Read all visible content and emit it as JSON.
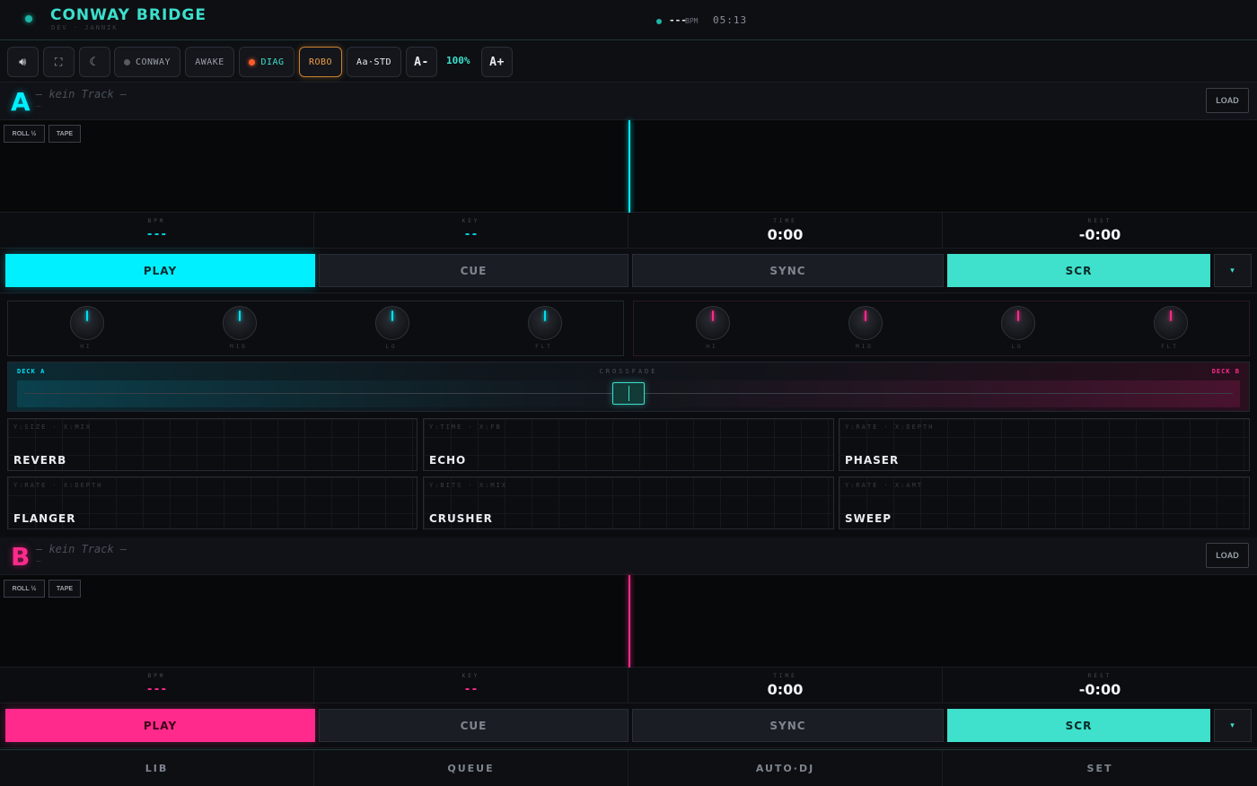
{
  "header": {
    "title": "CONWAY BRIDGE",
    "subtitle": "DEV · JANNIK",
    "bpm": "---",
    "bpm_unit": "BPM",
    "clock": "05:13"
  },
  "toolbar": {
    "conway_label": "CONWAY",
    "awake_label": "AWAKE",
    "diag_label": "DIAG",
    "robo_label": "ROBO",
    "font_std_label": "Aa·STD",
    "font_down_label": "A-",
    "zoom": "100%",
    "font_up_label": "A+"
  },
  "colors": {
    "deck_a": "#00f0ff",
    "deck_b": "#ff2a8c",
    "accent": "#3be0cc",
    "robo": "#f0a04b"
  },
  "deck_a": {
    "letter": "A",
    "track": "– kein Track –",
    "track_sub": "–",
    "load": "LOAD",
    "roll": "ROLL ½",
    "tape": "TAPE",
    "info": [
      {
        "label": "BPM",
        "value": "---"
      },
      {
        "label": "KEY",
        "value": "--"
      },
      {
        "label": "TIME",
        "value": "0:00"
      },
      {
        "label": "REST",
        "value": "-0:00"
      }
    ],
    "transport": {
      "play": "PLAY",
      "cue": "CUE",
      "sync": "SYNC",
      "scr": "SCR",
      "more_icon": "▾"
    },
    "eq": [
      "HI",
      "MID",
      "LO",
      "FLT"
    ]
  },
  "deck_b": {
    "letter": "B",
    "track": "– kein Track –",
    "track_sub": "–",
    "load": "LOAD",
    "roll": "ROLL ½",
    "tape": "TAPE",
    "info": [
      {
        "label": "BPM",
        "value": "---"
      },
      {
        "label": "KEY",
        "value": "--"
      },
      {
        "label": "TIME",
        "value": "0:00"
      },
      {
        "label": "REST",
        "value": "-0:00"
      }
    ],
    "transport": {
      "play": "PLAY",
      "cue": "CUE",
      "sync": "SYNC",
      "scr": "SCR",
      "more_icon": "▾"
    },
    "eq": [
      "HI",
      "MID",
      "LO",
      "FLT"
    ]
  },
  "crossfader": {
    "deck_a_label": "DECK A",
    "deck_b_label": "DECK B",
    "title": "CROSSFADE",
    "position": 0.5
  },
  "fx": [
    {
      "name": "REVERB",
      "params": "Y:SIZE · X:MIX"
    },
    {
      "name": "ECHO",
      "params": "Y:TIME · X:FB"
    },
    {
      "name": "PHASER",
      "params": "Y:RATE · X:DEPTH"
    },
    {
      "name": "FLANGER",
      "params": "Y:RATE · X:DEPTH"
    },
    {
      "name": "CRUSHER",
      "params": "Y:BITS · X:MIX"
    },
    {
      "name": "SWEEP",
      "params": "Y:RATE · X:AMT"
    }
  ],
  "nav": [
    "LIB",
    "QUEUE",
    "AUTO·DJ",
    "SET"
  ]
}
